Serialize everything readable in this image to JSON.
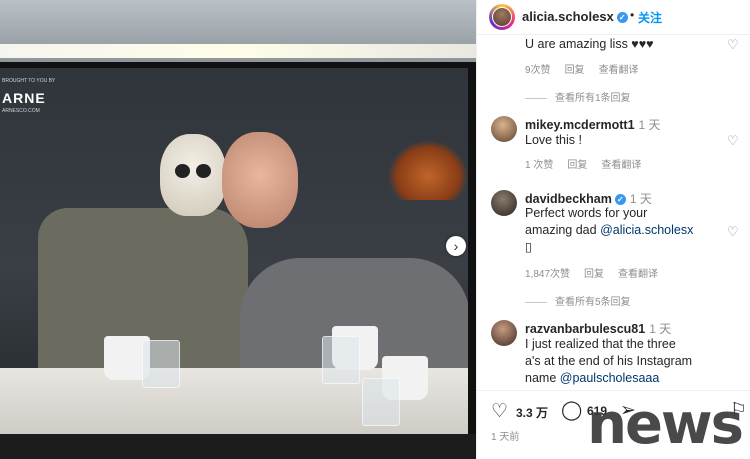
{
  "header": {
    "username": "alicia.scholesx",
    "follow": "关注",
    "dot": "•"
  },
  "photo": {
    "brand_sub": "BROUGHT TO YOU BY",
    "brand": "ARNE",
    "brand_url": "ARNESCO.COM",
    "next": "›"
  },
  "comments": [
    {
      "text": "U are amazing liss ♥♥♥",
      "meta": {
        "likes": "9次赞",
        "reply": "回复",
        "translate": "查看翻译"
      },
      "replies": "查看所有1条回复"
    },
    {
      "username": "mikey.mcdermott1",
      "time": "1 天",
      "text": "Love this !",
      "meta": {
        "likes": "1 次赞",
        "reply": "回复",
        "translate": "查看翻译"
      }
    },
    {
      "username": "davidbeckham",
      "time": "1 天",
      "text_line1": "Perfect words for your",
      "text_line2": "amazing dad ",
      "mention": "@alicia.scholesx",
      "text_line3": "▯",
      "meta": {
        "likes": "1,847次赞",
        "reply": "回复",
        "translate": "查看翻译"
      },
      "replies": "查看所有5条回复"
    },
    {
      "username": "razvanbarbulescu81",
      "time": "1 天",
      "text_line1": "I just realized that the three",
      "text_line2": "a's at the end of his Instagram",
      "text_line3_prefix": "name ",
      "mention": "@paulscholesaaa"
    }
  ],
  "actions": {
    "likes": "3.3 万",
    "comments": "619",
    "time": "1 天前"
  },
  "watermark": "news",
  "icons": [
    "verified-badge-icon",
    "heart-icon",
    "comment-icon",
    "share-icon",
    "bookmark-icon",
    "chevron-right-icon"
  ]
}
